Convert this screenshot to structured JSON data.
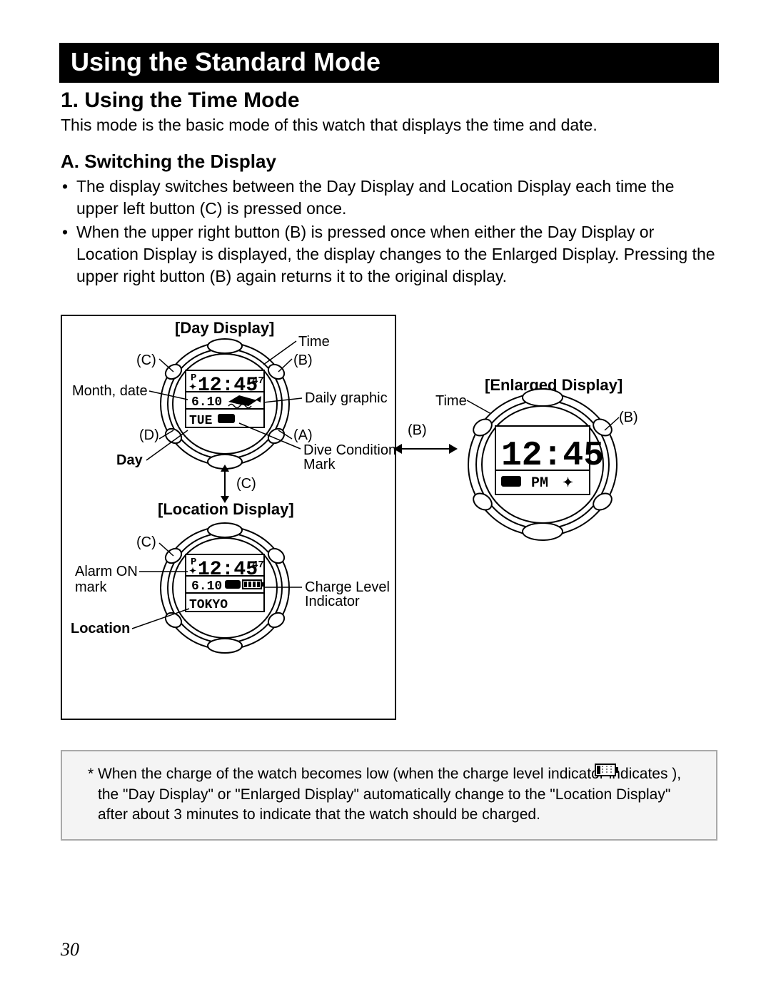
{
  "title": "Using the Standard Mode",
  "section": "1. Using the Time Mode",
  "intro": "This mode is the basic mode of this watch that displays the time and date.",
  "subheading": "A. Switching the Display",
  "bullets": [
    "The display switches between the Day Display and Location Display each time the upper left button (C) is pressed once.",
    "When the upper right button (B) is pressed once when either the Day Display or Location Display is displayed, the display changes to the Enlarged Display.  Pressing the upper right button (B) again returns it to the original display."
  ],
  "captions": {
    "day": "[Day Display]",
    "location": "[Location Display]",
    "enlarged": "[Enlarged Display]"
  },
  "buttons": {
    "A": "(A)",
    "B": "(B)",
    "C": "(C)",
    "D": "(D)"
  },
  "labels": {
    "time": "Time",
    "month_date": "Month, date",
    "daily_graphic": "Daily graphic",
    "day": "Day",
    "dive_condition": "Dive Condition",
    "mark": "Mark",
    "alarm_on": "Alarm ON",
    "alarm_on_mark": "mark",
    "charge_level": "Charge Level",
    "indicator": "Indicator",
    "location": "Location"
  },
  "lcd": {
    "time_main": "12:45",
    "seconds": "47",
    "p_marker": "P",
    "date": "6.10",
    "day_abbr": "TUE",
    "city": "TOKYO",
    "pm": "PM"
  },
  "note": "When the charge of the watch becomes low (when the charge level indicator indicates        ), the \"Day Display\" or \"Enlarged Display\" automatically change to the \"Location Display\" after about 3 minutes to indicate that the watch should be charged.",
  "page_number": "30"
}
